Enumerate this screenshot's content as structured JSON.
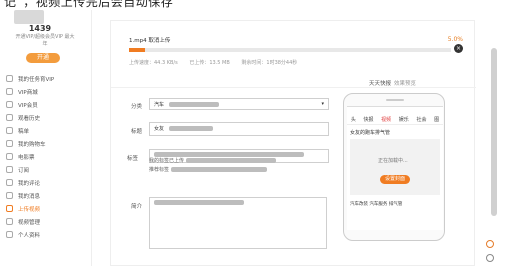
{
  "caption": "记”，视频上传完后会自动保存",
  "sidebar": {
    "count": "1439",
    "vip_note": "开通VIP/超级会员VIP 最大",
    "vip_note2": "年",
    "open_button": "开通",
    "items": [
      {
        "label": "我的任务育VIP",
        "icon": "task-icon"
      },
      {
        "label": "VIP商城",
        "icon": "shop-icon"
      },
      {
        "label": "VIP会员",
        "icon": "vip-icon"
      },
      {
        "label": "观看历史",
        "icon": "history-icon"
      },
      {
        "label": "稿单",
        "icon": "list-icon"
      },
      {
        "label": "我的购物车",
        "icon": "cart-icon"
      },
      {
        "label": "电影票",
        "icon": "ticket-icon"
      },
      {
        "label": "订阅",
        "icon": "subscribe-icon"
      },
      {
        "label": "我的评论",
        "icon": "comment-icon"
      },
      {
        "label": "我的消息",
        "icon": "message-icon"
      },
      {
        "label": "上传视频",
        "icon": "upload-icon",
        "active": true
      },
      {
        "label": "视频管理",
        "icon": "manage-icon"
      },
      {
        "label": "个人资料",
        "icon": "profile-icon"
      }
    ]
  },
  "upload": {
    "file_label": "1.mp4  取消上传",
    "percent_text": "5.0%",
    "progress": 5.0,
    "speed": "上传速度：44.3 KB/s",
    "uploaded": "已上传：13.5 MB",
    "remaining": "剩余时间：1时38分44秒"
  },
  "form": {
    "category_label": "分类",
    "category_value": "汽车",
    "title_label": "标题",
    "title_value": "女友",
    "tags_label": "标签",
    "hint_line1": "我的标签已上传",
    "hint_line2": "推荐标签",
    "intro_label": "简介"
  },
  "preview": {
    "title": "天天快报",
    "title_sub": "效果预览",
    "tabs": [
      "头",
      "快报",
      "视频",
      "娱乐",
      "社会",
      "图"
    ],
    "active_tab": 2,
    "video_title": "女友的跑车排气管",
    "loading_text": "正在加载中...",
    "play_label": "设置封面",
    "bottom_text": "汽车改装  汽车服务  排气管"
  },
  "colors": {
    "accent": "#f07c22",
    "tab_active": "#e04040"
  }
}
